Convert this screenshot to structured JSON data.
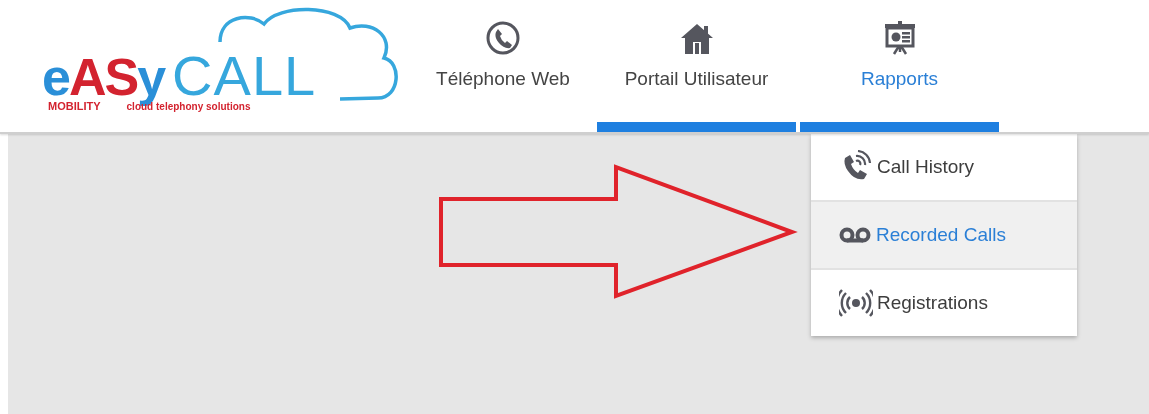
{
  "logo": {
    "wordmark": [
      {
        "text": "e",
        "color": "#2a8fd8"
      },
      {
        "text": "AS",
        "color": "#d3232f"
      },
      {
        "text": "y",
        "color": "#2a8fd8"
      }
    ],
    "call": "CALL",
    "mobility": "MOBILITY",
    "tagline": "cloud telephony solutions"
  },
  "tabs": [
    {
      "label": "Téléphone Web",
      "kind": "phone",
      "selected": false,
      "underlined": false
    },
    {
      "label": "Portail Utilisateur",
      "kind": "home",
      "selected": false,
      "underlined": true
    },
    {
      "label": "Rapports",
      "kind": "board",
      "selected": true,
      "underlined": true
    }
  ],
  "menu": {
    "items": [
      {
        "label": "Call History",
        "kind": "history",
        "selected": false
      },
      {
        "label": "Recorded Calls",
        "kind": "voicemail",
        "selected": true
      },
      {
        "label": "Registrations",
        "kind": "broadcast",
        "selected": false
      }
    ]
  }
}
